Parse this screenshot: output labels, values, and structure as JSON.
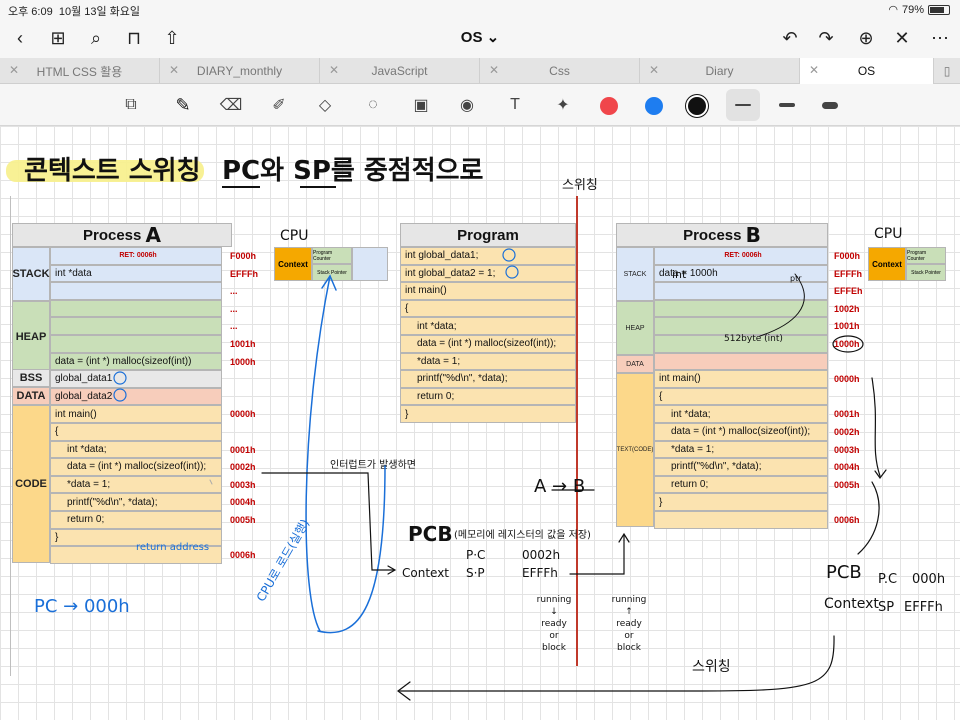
{
  "status": {
    "time": "오후 6:09",
    "date": "10월 13일 화요일",
    "battery": "79%",
    "battery_level": 0.79
  },
  "nav": {
    "title": "OS"
  },
  "tabs": [
    {
      "label": "HTML CSS 활용",
      "active": false
    },
    {
      "label": "DIARY_monthly",
      "active": false
    },
    {
      "label": "JavaScript",
      "active": false
    },
    {
      "label": "Css",
      "active": false
    },
    {
      "label": "Diary",
      "active": false
    },
    {
      "label": "OS",
      "active": true
    }
  ],
  "toolbar": {
    "tools": [
      "page-icon",
      "pen-icon",
      "eraser-icon",
      "highlighter-icon",
      "shapes-icon",
      "lasso-icon",
      "image-icon",
      "camera-icon",
      "text-icon",
      "laser-icon"
    ],
    "colors": [
      "#f0464b",
      "#1e7df0",
      "#111111"
    ],
    "strokes": [
      "thin",
      "medium",
      "thick"
    ]
  },
  "note": {
    "title_part1": "콘텍스트 스위칭",
    "title_part2": "PC와 SP를 중점적으로",
    "switch_label": "스위칭",
    "pc_note": "PC → 000h",
    "cpu_note": "CPU로 로드(실행)",
    "return_address": "return address",
    "interrupt_note": "인터럽트가 발생하면",
    "a_to_b": "A → B",
    "pcb_title": "PCB",
    "pcb_subtitle": "(메모리에 레지스터의 값을 저장)",
    "pcb_context": "Context",
    "pcb_rows": [
      {
        "reg": "P·C",
        "val": "0002h"
      },
      {
        "reg": "S·P",
        "val": "EFFFh"
      }
    ],
    "state_a": [
      "running",
      "↓",
      "ready",
      "or",
      "block"
    ],
    "state_b": [
      "running",
      "↑",
      "ready",
      "or",
      "block"
    ],
    "pcb_b_title": "PCB",
    "pcb_b_context": "Context",
    "pcb_b_rows": [
      {
        "reg": "P.C",
        "val": "000h"
      },
      {
        "reg": "SP",
        "val": "EFFFh"
      }
    ],
    "switch_bottom": "스위칭",
    "heap_int_note": "512byte (int)",
    "stack_int_note": "int",
    "arrow_note": "ptr"
  },
  "process_a": {
    "title": "Process",
    "title_letter": "A",
    "segments": {
      "stack": "STACK",
      "heap": "HEAP",
      "bss": "BSS",
      "data": "DATA",
      "code": "CODE"
    },
    "rows": [
      {
        "text": "RET: 0006h",
        "addr": "F000h",
        "seg": "stack"
      },
      {
        "text": "int *data",
        "addr": "EFFFh",
        "seg": "stack"
      },
      {
        "text": "",
        "addr": "...",
        "seg": "stack"
      },
      {
        "text": "",
        "addr": "...",
        "seg": "heap"
      },
      {
        "text": "",
        "addr": "...",
        "seg": "heap"
      },
      {
        "text": "",
        "addr": "1001h",
        "seg": "heap"
      },
      {
        "text": "data = (int *) malloc(sizeof(int))",
        "addr": "1000h",
        "seg": "heap"
      },
      {
        "text": "global_data1",
        "addr": "",
        "seg": "bss"
      },
      {
        "text": "global_data2",
        "addr": "",
        "seg": "data"
      },
      {
        "text": "int main()",
        "addr": "0000h",
        "seg": "code"
      },
      {
        "text": "{",
        "addr": "",
        "seg": "code"
      },
      {
        "text": "int *data;",
        "addr": "0001h",
        "seg": "code"
      },
      {
        "text": "data = (int *) malloc(sizeof(int));",
        "addr": "0002h",
        "seg": "code"
      },
      {
        "text": "*data = 1;",
        "addr": "0003h",
        "seg": "code"
      },
      {
        "text": "printf(\"%d\\n\", *data);",
        "addr": "0004h",
        "seg": "code"
      },
      {
        "text": "return 0;",
        "addr": "0005h",
        "seg": "code"
      },
      {
        "text": "}",
        "addr": "",
        "seg": "code"
      },
      {
        "text": "",
        "addr": "0006h",
        "seg": "code"
      }
    ]
  },
  "cpu_a": {
    "label": "CPU",
    "context": "Context",
    "pc": "Program Counter",
    "sp": "Stack Pointer"
  },
  "program": {
    "title": "Program",
    "lines": [
      "int global_data1;",
      "int global_data2 = 1;",
      "int main()",
      "{",
      "int *data;",
      "data = (int *) malloc(sizeof(int));",
      "*data = 1;",
      "printf(\"%d\\n\", *data);",
      "return 0;",
      "}"
    ]
  },
  "process_b": {
    "title": "Process",
    "title_letter": "B",
    "segments": {
      "stack": "STACK",
      "heap": "HEAP",
      "data": "DATA",
      "code": "TEXT(CODE)"
    },
    "rows": [
      {
        "text": "RET: 0006h",
        "addr": "F000h",
        "seg": "stack"
      },
      {
        "text": "data = 1000h",
        "addr": "EFFFh",
        "seg": "stack"
      },
      {
        "text": "",
        "addr": "EFFEh",
        "seg": "stack"
      },
      {
        "text": "",
        "addr": "1002h",
        "seg": "heap"
      },
      {
        "text": "",
        "addr": "1001h",
        "seg": "heap"
      },
      {
        "text": "",
        "addr": "1000h",
        "seg": "heap"
      },
      {
        "text": "",
        "addr": "",
        "seg": "data"
      },
      {
        "text": "int main()",
        "addr": "0000h",
        "seg": "code"
      },
      {
        "text": "{",
        "addr": "",
        "seg": "code"
      },
      {
        "text": "int *data;",
        "addr": "0001h",
        "seg": "code"
      },
      {
        "text": "data = (int *) malloc(sizeof(int));",
        "addr": "0002h",
        "seg": "code"
      },
      {
        "text": "*data = 1;",
        "addr": "0003h",
        "seg": "code"
      },
      {
        "text": "printf(\"%d\\n\", *data);",
        "addr": "0004h",
        "seg": "code"
      },
      {
        "text": "return 0;",
        "addr": "0005h",
        "seg": "code"
      },
      {
        "text": "}",
        "addr": "",
        "seg": "code"
      },
      {
        "text": "",
        "addr": "0006h",
        "seg": "code"
      }
    ]
  },
  "cpu_b": {
    "label": "CPU",
    "context": "Context",
    "pc": "Program Counter",
    "sp": "Stack Pointer"
  }
}
